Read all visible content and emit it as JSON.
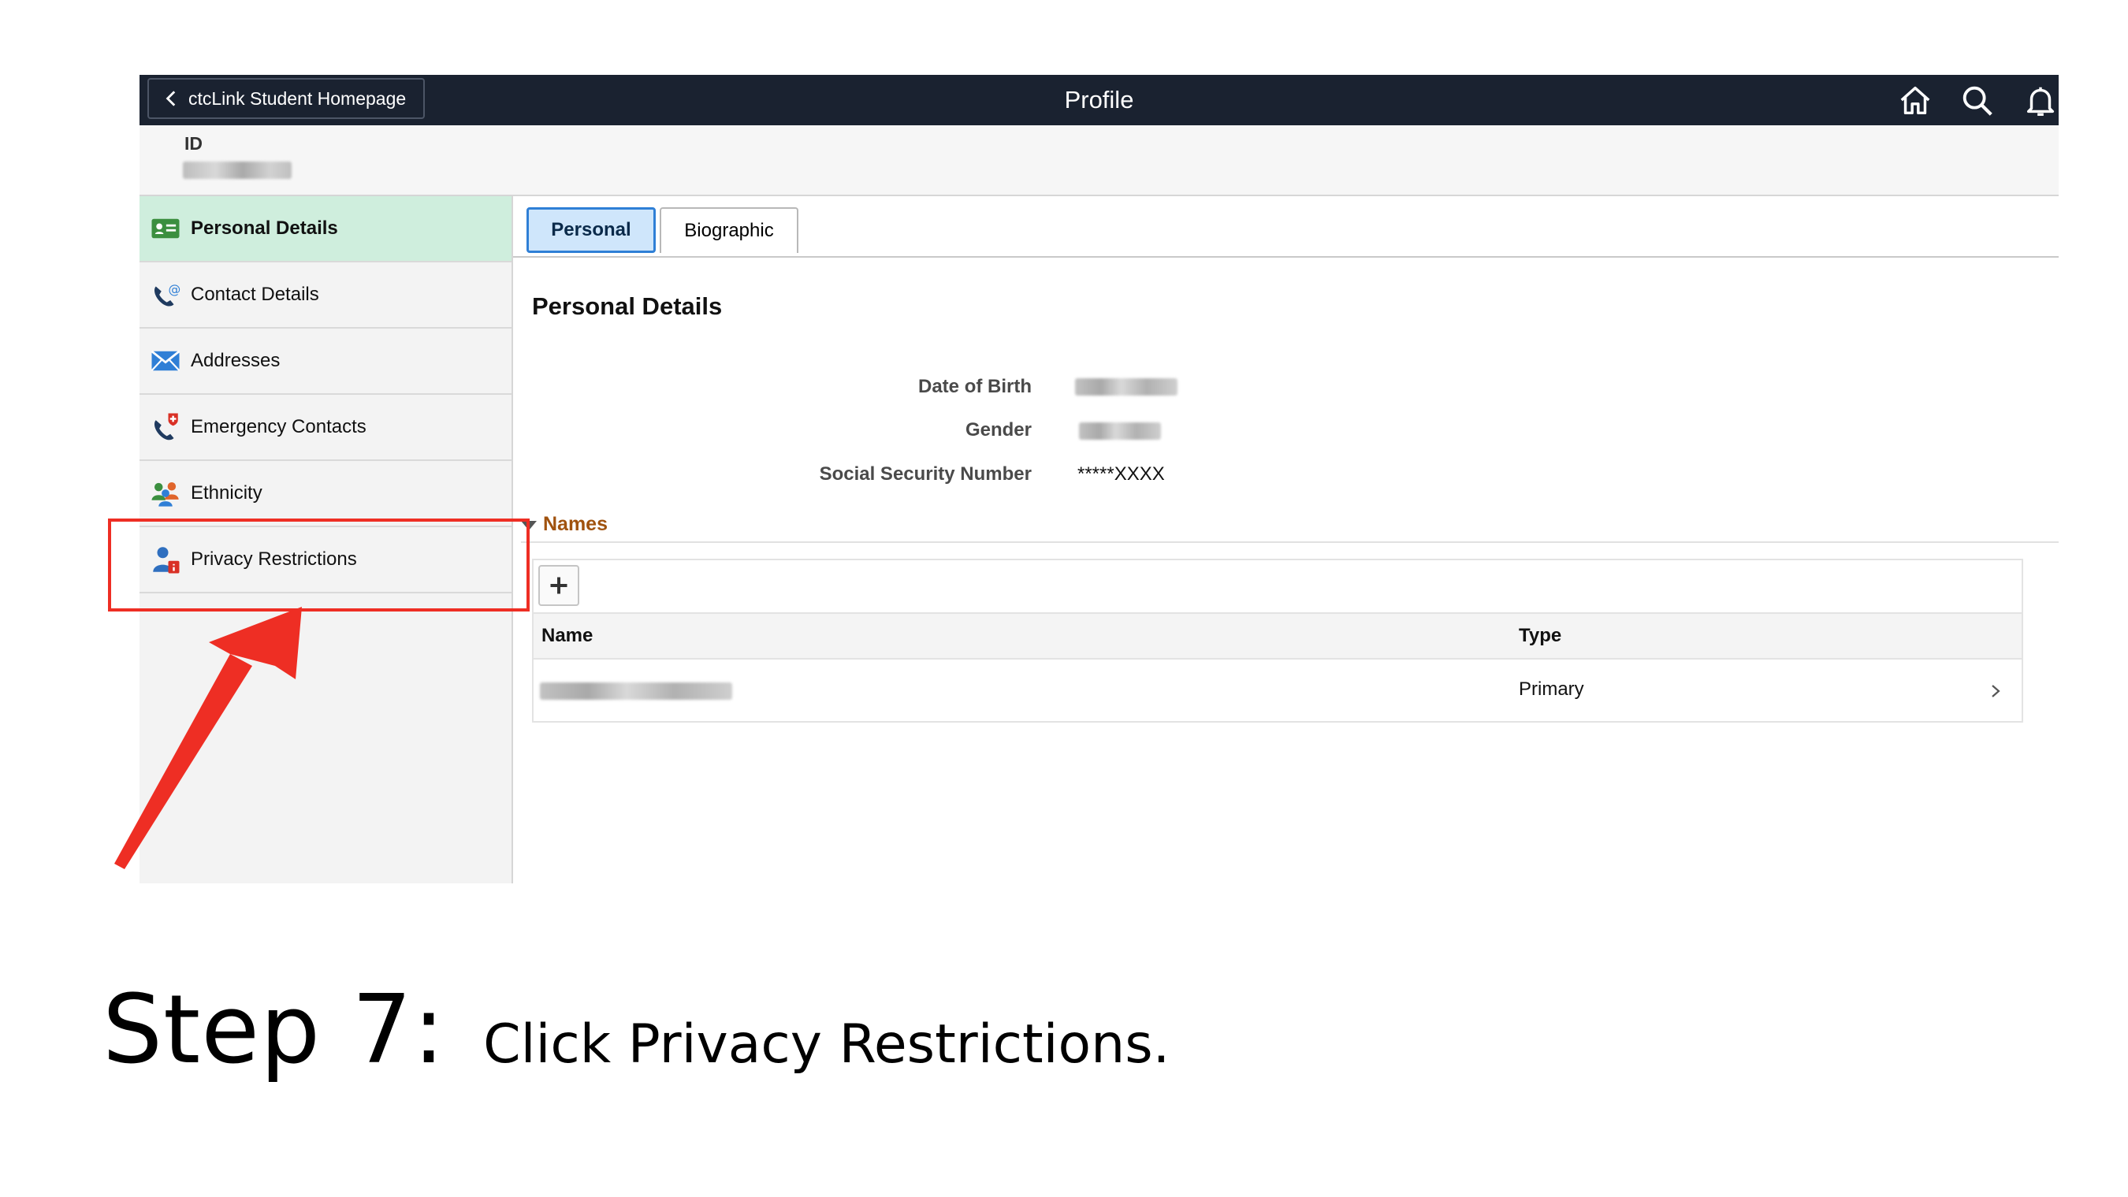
{
  "topbar": {
    "back_label": "ctcLink Student Homepage",
    "title": "Profile",
    "icons": [
      "home-icon",
      "search-icon",
      "notification-bell-icon"
    ]
  },
  "id_bar": {
    "label": "ID"
  },
  "sidebar": {
    "items": [
      {
        "label": "Personal Details",
        "icon": "personal-details-icon",
        "active": true
      },
      {
        "label": "Contact Details",
        "icon": "contact-phone-icon",
        "active": false
      },
      {
        "label": "Addresses",
        "icon": "envelope-icon",
        "active": false
      },
      {
        "label": "Emergency Contacts",
        "icon": "emergency-phone-icon",
        "active": false
      },
      {
        "label": "Ethnicity",
        "icon": "people-group-icon",
        "active": false
      },
      {
        "label": "Privacy Restrictions",
        "icon": "privacy-user-icon",
        "active": false
      }
    ]
  },
  "tabs": [
    {
      "label": "Personal",
      "active": true
    },
    {
      "label": "Biographic",
      "active": false
    }
  ],
  "personal": {
    "section_title": "Personal Details",
    "fields": [
      {
        "label": "Date of Birth"
      },
      {
        "label": "Gender"
      },
      {
        "label": "Social Security Number",
        "value": "*****XXXX"
      }
    ]
  },
  "names": {
    "header": "Names",
    "columns": [
      "Name",
      "Type"
    ],
    "rows": [
      {
        "type": "Primary"
      }
    ]
  },
  "annotation": {
    "highlight_color": "#ee2e24"
  },
  "caption": {
    "step": "Step 7:",
    "instruction": "Click Privacy Restrictions."
  }
}
